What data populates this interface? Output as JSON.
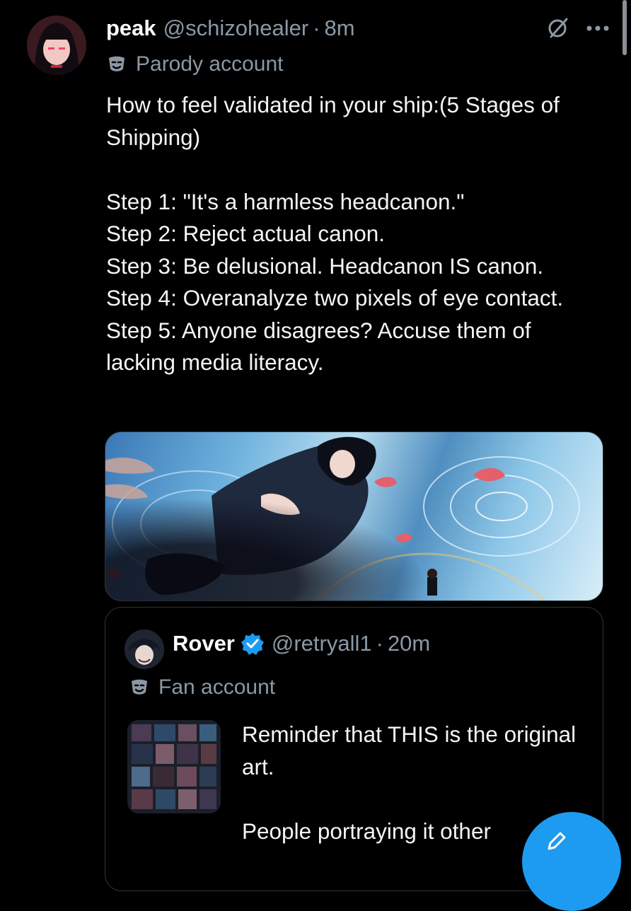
{
  "post": {
    "display_name": "peak",
    "handle": "@schizohealer",
    "separator": "·",
    "time": "8m",
    "badge_text": "Parody account",
    "text": "How to feel validated in your ship:(5 Stages of Shipping)\n\nStep 1: \"It's a harmless headcanon.\"\nStep 2: Reject actual canon.\nStep 3: Be delusional. Headcanon IS canon.\nStep 4: Overanalyze two pixels of eye contact.\nStep 5: Anyone disagrees? Accuse them of lacking media literacy."
  },
  "quote": {
    "display_name": "Rover",
    "handle": "@retryall1",
    "separator": "·",
    "time": "20m",
    "badge_text": "Fan account",
    "text": "Reminder that THIS is the original art.\n\nPeople portraying it other"
  },
  "icons": {
    "grok": "grok-icon",
    "more": "more-icon",
    "mask": "mask-icon",
    "verified": "verified-icon",
    "compose": "compose-icon"
  },
  "colors": {
    "background": "#000000",
    "text_primary": "#e7e9ea",
    "text_secondary": "#8b98a5",
    "accent": "#1d9bf0"
  }
}
